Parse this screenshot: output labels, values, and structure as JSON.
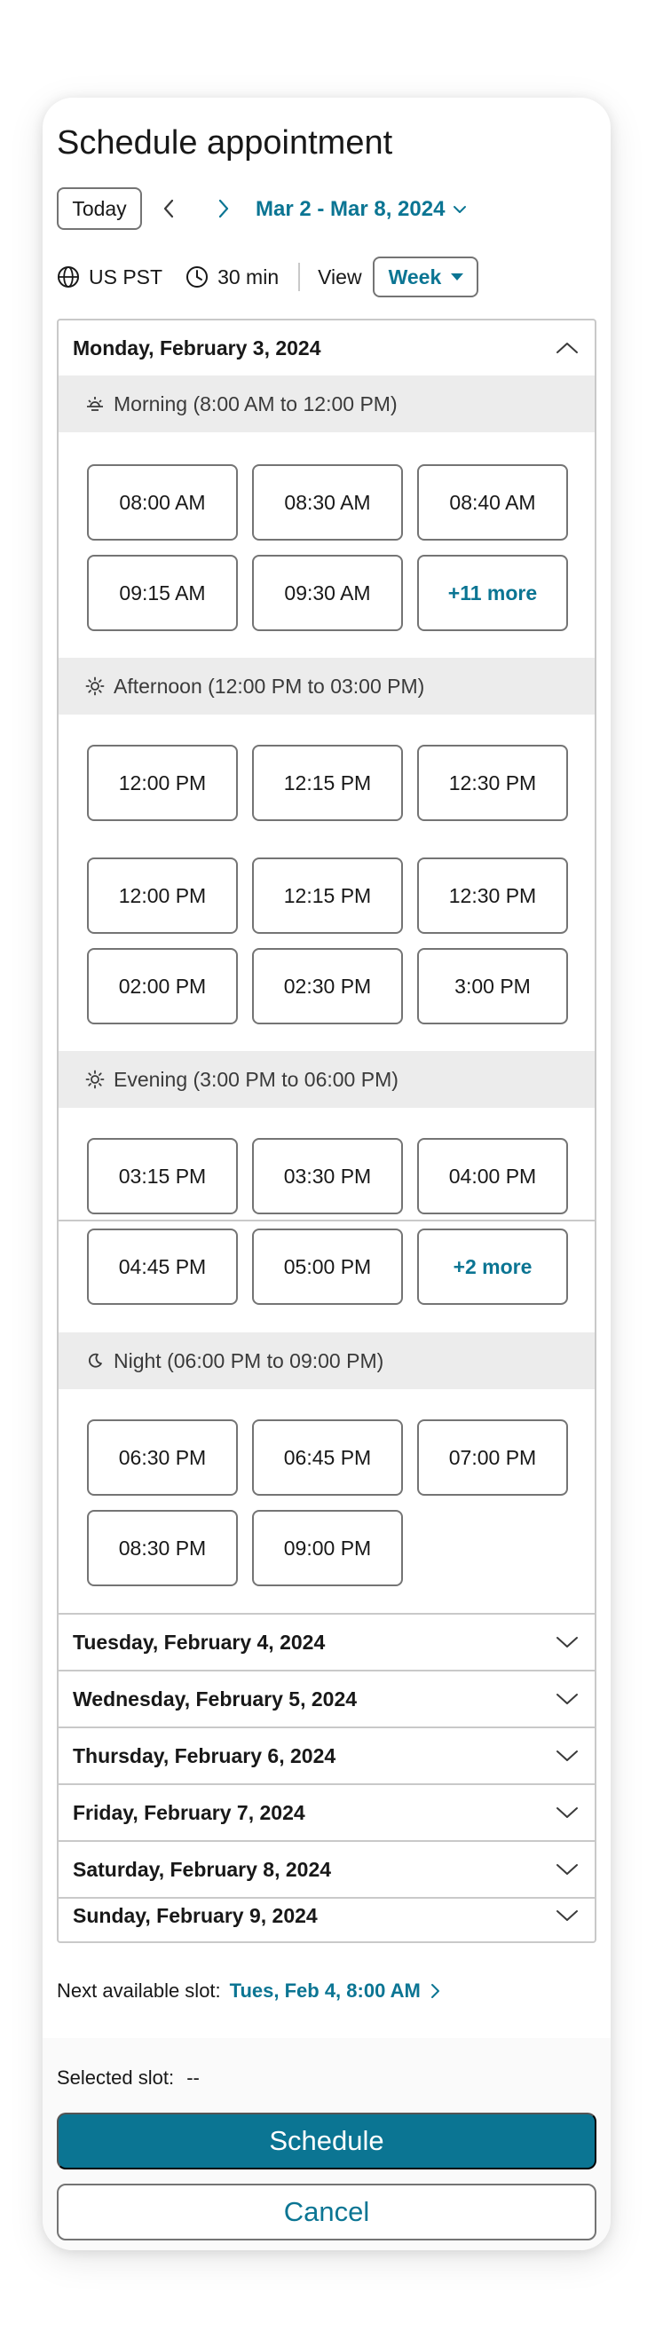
{
  "header": {
    "title": "Schedule appointment"
  },
  "toolbar": {
    "today_label": "Today",
    "date_range": "Mar 2 - Mar 8, 2024",
    "timezone": "US PST",
    "duration": "30 min",
    "view_label": "View",
    "view_value": "Week"
  },
  "days": {
    "monday": {
      "label": "Monday, February 3, 2024",
      "morning": {
        "label": "Morning (8:00 AM to 12:00 PM)",
        "slots": [
          "08:00 AM",
          "08:30 AM",
          "08:40 AM",
          "09:15 AM",
          "09:30 AM",
          "+11 more"
        ]
      },
      "afternoon": {
        "label": "Afternoon (12:00 PM to 03:00 PM)",
        "slots": [
          "12:00 PM",
          "12:15 PM",
          "12:30 PM",
          "12:00 PM",
          "12:15 PM",
          "12:30 PM",
          "02:00 PM",
          "02:30 PM",
          "3:00 PM"
        ]
      },
      "evening": {
        "label": "Evening (3:00 PM to 06:00 PM)",
        "slots": [
          "03:15 PM",
          "03:30 PM",
          "04:00 PM",
          "04:45 PM",
          "05:00 PM",
          "+2 more"
        ]
      },
      "night": {
        "label": "Night (06:00 PM to 09:00 PM)",
        "slots": [
          "06:30 PM",
          "06:45 PM",
          "07:00 PM",
          "08:30 PM",
          "09:00 PM"
        ]
      }
    },
    "collapsed": [
      "Tuesday, February 4, 2024",
      "Wednesday, February 5, 2024",
      "Thursday, February 6, 2024",
      "Friday, February 7, 2024",
      "Saturday, February 8, 2024",
      "Sunday, February 9, 2024"
    ]
  },
  "next_slot": {
    "label": "Next available slot:",
    "value": "Tues, Feb 4, 8:00 AM"
  },
  "footer": {
    "selected_label": "Selected slot:",
    "selected_value": "--",
    "schedule_label": "Schedule",
    "cancel_label": "Cancel"
  },
  "colors": {
    "accent": "#0b7593",
    "border": "#747474",
    "divider": "#c9c9c9",
    "section_bg": "#ececec"
  },
  "icons": [
    "chevron-left-icon",
    "chevron-right-icon",
    "chevron-down-icon",
    "globe-icon",
    "clock-icon",
    "caret-down-icon",
    "chevron-up-icon",
    "sun-low-icon",
    "sun-icon",
    "moon-icon"
  ]
}
